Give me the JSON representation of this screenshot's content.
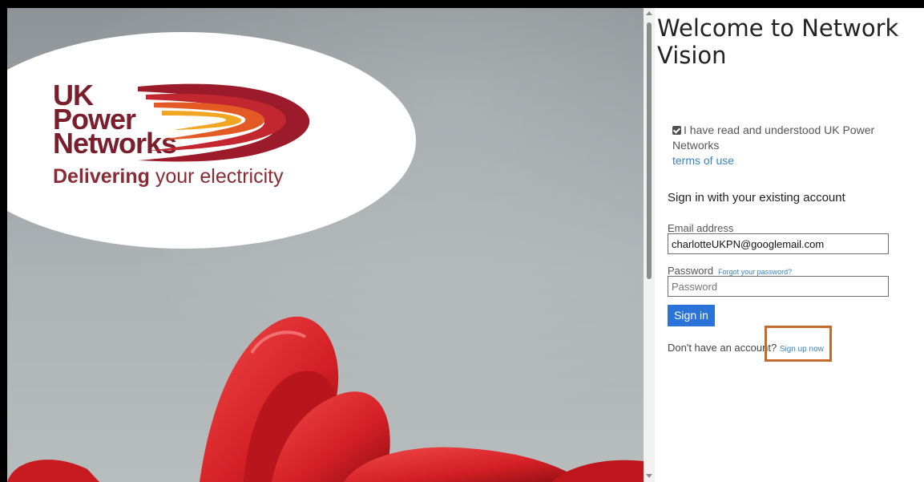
{
  "brand": {
    "line1": "UK",
    "line2": "Power",
    "line3": "Networks",
    "tagline_bold": "Delivering",
    "tagline_rest": " your electricity",
    "primary_color": "#7a1e2c",
    "accent_color": "#f0a623"
  },
  "page": {
    "title": "Welcome to Network Vision"
  },
  "terms": {
    "checked": true,
    "text": "I have read and understood UK Power Networks",
    "link_label": "terms of use"
  },
  "signin": {
    "heading": "Sign in with your existing account",
    "email_label": "Email address",
    "email_value": "charlotteUKPN@googlemail.com",
    "password_label": "Password",
    "forgot_label": "Forgot your password?",
    "password_placeholder": "Password",
    "button_label": "Sign in",
    "button_color": "#2b73d8"
  },
  "signup": {
    "prompt": "Don't have an account?",
    "link_label": "Sign up now",
    "highlight_color": "#c46a2a"
  }
}
